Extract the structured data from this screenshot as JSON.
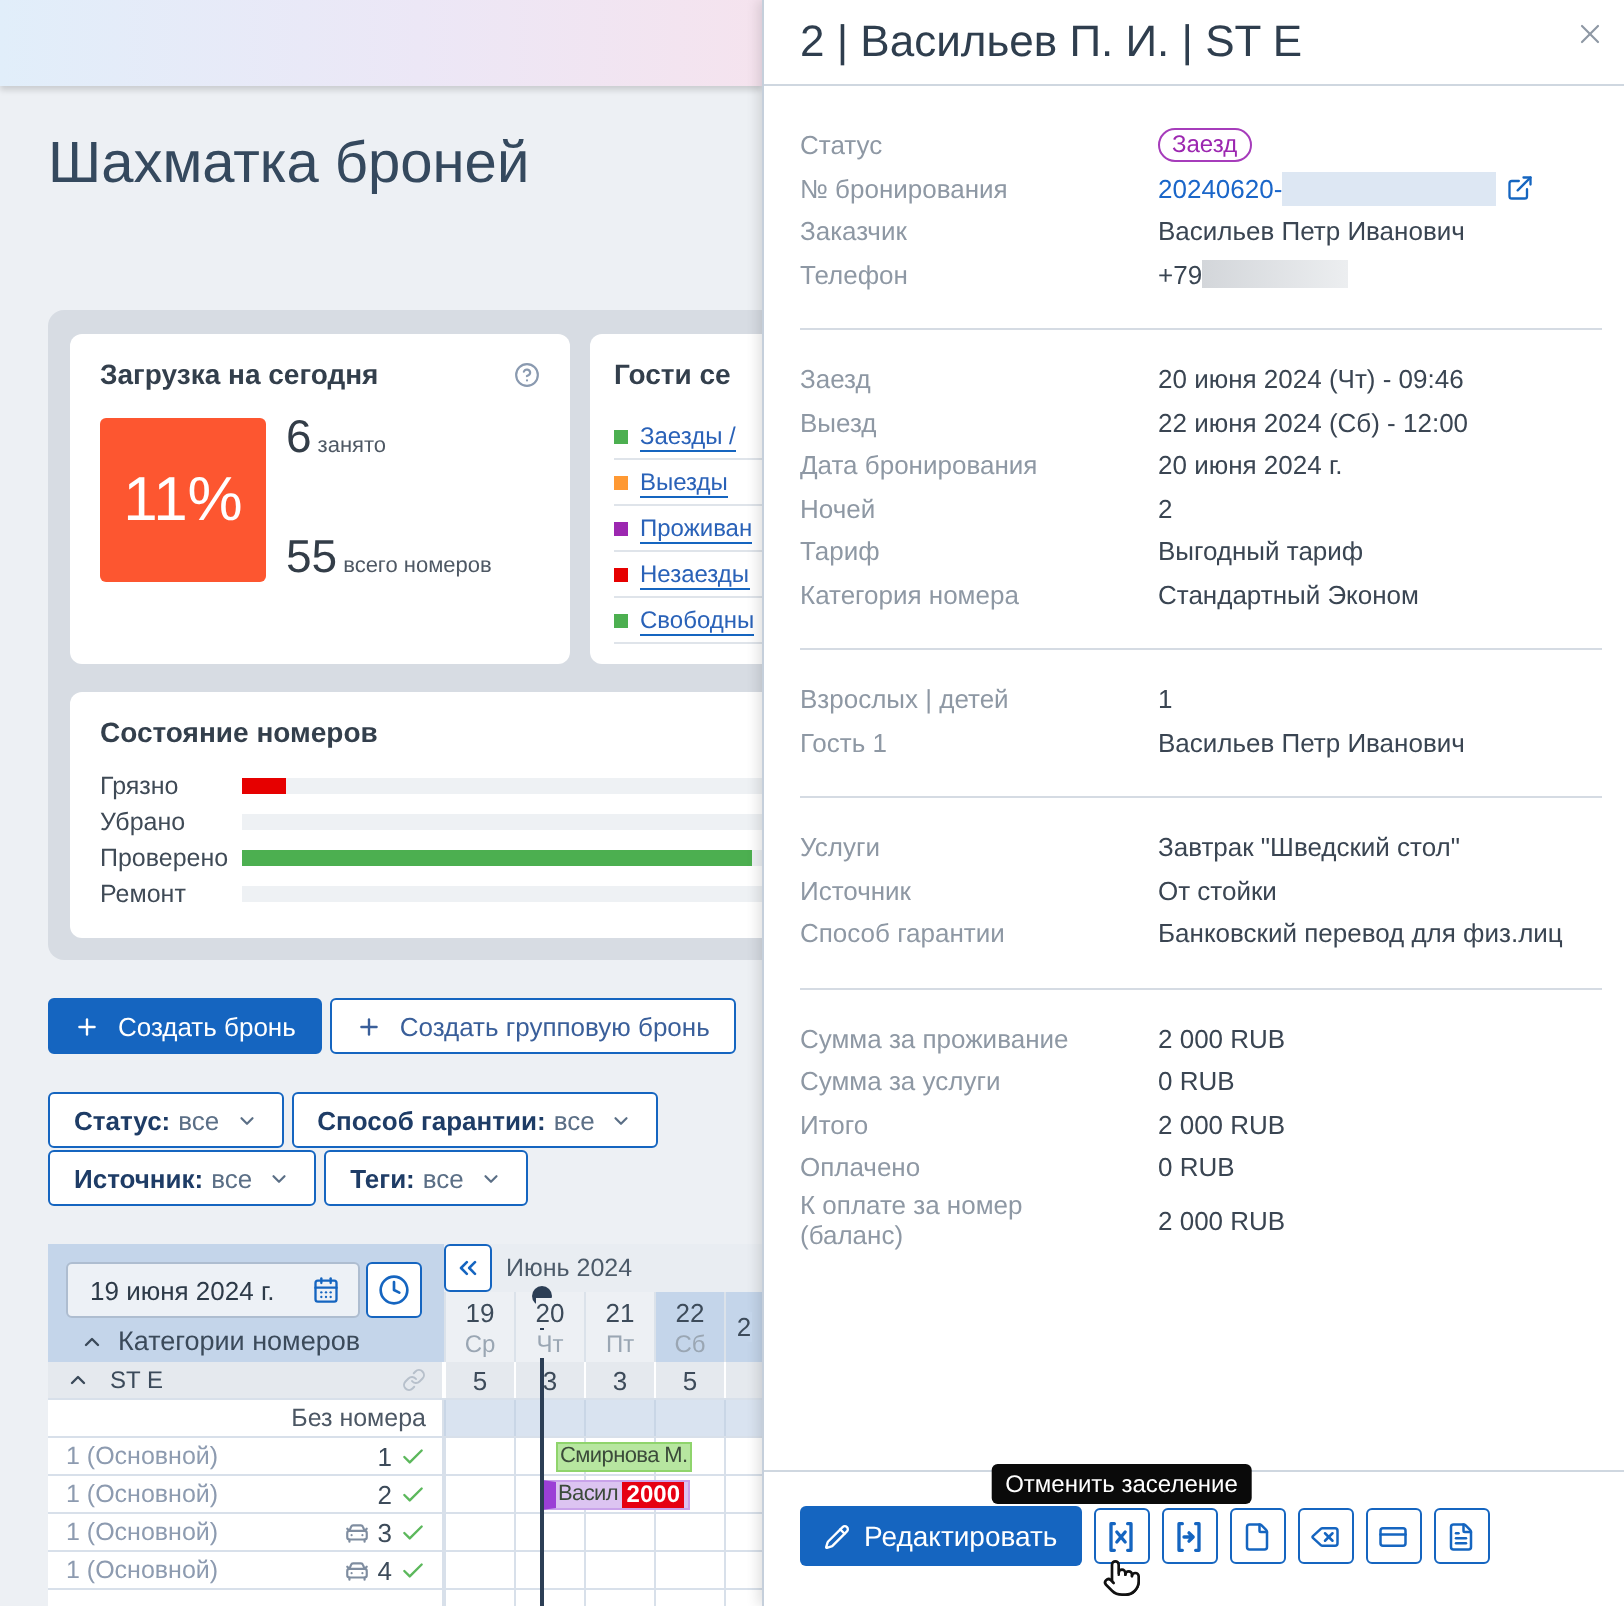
{
  "page": {
    "title": "Шахматка броней"
  },
  "load_card": {
    "title": "Загрузка на сегодня",
    "percent": "11%",
    "occupied": {
      "value": "6",
      "label": "занято"
    },
    "total": {
      "value": "55",
      "label": "всего номеров"
    }
  },
  "guests_card": {
    "title": "Гости се",
    "items": [
      {
        "label": "Заезды /",
        "color": "#4caf50"
      },
      {
        "label": "Выезды",
        "color": "#ff9933"
      },
      {
        "label": "Проживан",
        "color": "#9c27b0"
      },
      {
        "label": "Незаезды",
        "color": "#e60000"
      },
      {
        "label": "Свободны",
        "color": "#4caf50"
      }
    ]
  },
  "room_state_card": {
    "title": "Состояние номеров",
    "rows": [
      {
        "label": "Грязно",
        "level": 0.085,
        "color": "#e60000"
      },
      {
        "label": "Убрано",
        "level": 0
      },
      {
        "label": "Проверено",
        "level": 0.98,
        "color": "#4caf50"
      },
      {
        "label": "Ремонт",
        "level": 0
      }
    ]
  },
  "actions": [
    {
      "label": "Создать бронь",
      "kind": "primary"
    },
    {
      "label": "Создать групповую бронь",
      "kind": "secondary"
    }
  ],
  "filter_rows": [
    [
      {
        "label": "Статус:",
        "value": "все"
      },
      {
        "label": "Способ гарантии:",
        "value": "все"
      }
    ],
    [
      {
        "label": "Источник:",
        "value": "все"
      },
      {
        "label": "Теги:",
        "value": "все"
      }
    ]
  ],
  "calendar": {
    "date_field": {
      "value": "19 июня 2024 г."
    },
    "categories": {
      "label": "Категории номеров",
      "expanded": true
    },
    "month": "Июнь 2024",
    "days": [
      {
        "day": "19",
        "weekday": "Ср",
        "weekend": false
      },
      {
        "day": "20",
        "weekday": "Чт",
        "weekend": false
      },
      {
        "day": "21",
        "weekday": "Пт",
        "weekend": false
      },
      {
        "day": "22",
        "weekday": "Сб",
        "weekend": true
      },
      {
        "day": "2",
        "weekend": true
      }
    ],
    "category": {
      "name": "ST E",
      "expanded": true,
      "counts": [
        "5",
        "3",
        "3",
        "5"
      ]
    },
    "unassigned": {
      "label": "Без номера"
    },
    "rooms": [
      {
        "label": "1 (Основной)",
        "number": "1",
        "car": false,
        "clean": true,
        "booking": {
          "guest": "Смирнова М.",
          "kind": "confirmed"
        }
      },
      {
        "label": "1 (Основной)",
        "number": "2",
        "car": false,
        "clean": true,
        "booking": {
          "guest": "Васил",
          "kind": "checked_in",
          "amount": "2000"
        }
      },
      {
        "label": "1 (Основной)",
        "number": "3",
        "car": true,
        "clean": true
      },
      {
        "label": "1 (Основной)",
        "number": "4",
        "car": true,
        "clean": true
      }
    ]
  },
  "booking_panel": {
    "title": "2 | Васильев П. И. | ST E",
    "sections": [
      [
        {
          "label": "Статус",
          "value": "Заезд",
          "kind": "badge"
        },
        {
          "label": "№ бронирования",
          "value": "20240620-",
          "kind": "link",
          "masked": true
        },
        {
          "label": "Заказчик",
          "value": "Васильев Петр Иванович",
          "kind": "text"
        },
        {
          "label": "Телефон",
          "value": "+79",
          "kind": "text",
          "masked": true
        }
      ],
      [
        {
          "label": "Заезд",
          "value": "20 июня 2024 (Чт) - 09:46",
          "kind": "text"
        },
        {
          "label": "Выезд",
          "value": "22 июня 2024 (Сб) - 12:00",
          "kind": "text"
        },
        {
          "label": "Дата бронирования",
          "value": "20 июня 2024 г.",
          "kind": "text"
        },
        {
          "label": "Ночей",
          "value": "2",
          "kind": "text"
        },
        {
          "label": "Тариф",
          "value": "Выгодный тариф",
          "kind": "text"
        },
        {
          "label": "Категория номера",
          "value": "Стандартный Эконом",
          "kind": "text"
        }
      ],
      [
        {
          "label": "Взрослых | детей",
          "value": "1",
          "kind": "text"
        },
        {
          "label": "Гость 1",
          "value": "Васильев Петр Иванович",
          "kind": "text"
        }
      ],
      [
        {
          "label": "Услуги",
          "value": "Завтрак \"Шведский стол\"",
          "kind": "text"
        },
        {
          "label": "Источник",
          "value": "От стойки",
          "kind": "text"
        },
        {
          "label": "Способ гарантии",
          "value": "Банковский перевод для физ.лиц",
          "kind": "text"
        }
      ],
      [
        {
          "label": "Сумма за проживание",
          "value": "2 000 RUB",
          "kind": "text"
        },
        {
          "label": "Сумма за услуги",
          "value": "0 RUB",
          "kind": "text"
        },
        {
          "label": "Итого",
          "value": "2 000 RUB",
          "kind": "text"
        },
        {
          "label": "Оплачено",
          "value": "0 RUB",
          "kind": "text"
        },
        {
          "label": "К оплате за номер (баланс)",
          "value": "2 000 RUB",
          "kind": "text"
        }
      ]
    ],
    "footer": {
      "edit_button": {
        "label": "Редактировать"
      },
      "icon_buttons": [
        {
          "kind": "cancel_checkin",
          "tooltip": "Отменить заселение"
        },
        {
          "kind": "checkin"
        },
        {
          "kind": "document"
        },
        {
          "kind": "delete"
        },
        {
          "kind": "payment"
        },
        {
          "kind": "invoice"
        }
      ]
    }
  }
}
